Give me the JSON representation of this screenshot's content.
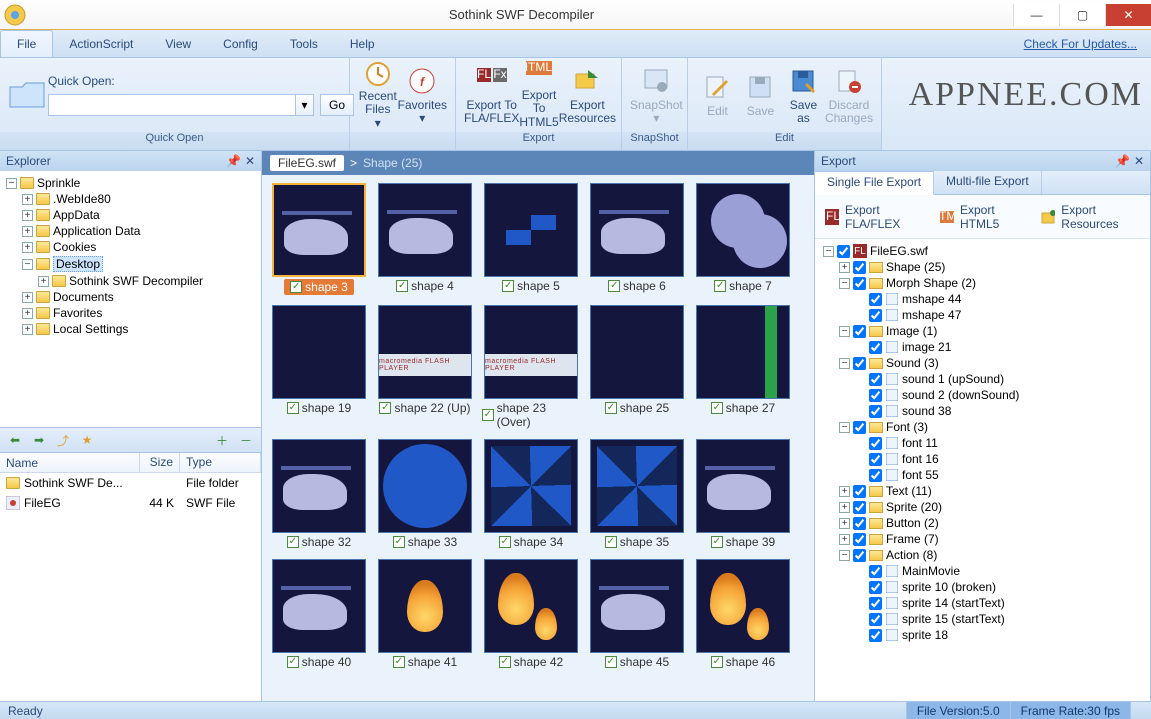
{
  "title": "Sothink SWF Decompiler",
  "watermark": "APPNEE.COM",
  "menubar": {
    "items": [
      "File",
      "ActionScript",
      "View",
      "Config",
      "Tools",
      "Help"
    ],
    "updates": "Check For Updates..."
  },
  "ribbon": {
    "quick_open": {
      "label": "Quick Open:",
      "go": "Go",
      "group": "Quick Open"
    },
    "recent": "Recent Files",
    "favorites": "Favorites",
    "export_fla": "Export To FLA/FLEX",
    "export_html5": "Export To HTML5",
    "export_res": "Export Resources",
    "export_group": "Export",
    "snapshot": "SnapShot",
    "snapshot_group": "SnapShot",
    "edit": "Edit",
    "save": "Save",
    "save_as": "Save as",
    "discard": "Discard Changes",
    "edit_group": "Edit"
  },
  "explorer": {
    "title": "Explorer",
    "root": "Sprinkle",
    "children": [
      ".WebIde80",
      "AppData",
      "Application Data",
      "Cookies",
      "Desktop",
      "Documents",
      "Favorites",
      "Local Settings"
    ],
    "desktop_child": "Sothink SWF Decompiler"
  },
  "file_list": {
    "cols": {
      "name": "Name",
      "size": "Size",
      "type": "Type"
    },
    "rows": [
      {
        "name": "Sothink SWF De...",
        "size": "",
        "type": "File folder",
        "icon": "folder"
      },
      {
        "name": "FileEG",
        "size": "44 K",
        "type": "SWF File",
        "icon": "swf"
      }
    ]
  },
  "breadcrumb": {
    "file": "FileEG.swf",
    "sep": ">",
    "section": "Shape (25)"
  },
  "thumbs": [
    {
      "id": "shape 3",
      "kind": "heli",
      "selected": true
    },
    {
      "id": "shape 4",
      "kind": "heli"
    },
    {
      "id": "shape 5",
      "kind": "bowtie"
    },
    {
      "id": "shape 6",
      "kind": "heli"
    },
    {
      "id": "shape 7",
      "kind": "clouds"
    },
    {
      "id": "shape 19",
      "kind": "plain"
    },
    {
      "id": "shape 22 (Up)",
      "kind": "mm"
    },
    {
      "id": "shape 23 (Over)",
      "kind": "mm"
    },
    {
      "id": "shape 25",
      "kind": "plain"
    },
    {
      "id": "shape 27",
      "kind": "vstripe"
    },
    {
      "id": "shape 32",
      "kind": "heli"
    },
    {
      "id": "shape 33",
      "kind": "circle"
    },
    {
      "id": "shape 34",
      "kind": "cross4"
    },
    {
      "id": "shape 35",
      "kind": "cross4"
    },
    {
      "id": "shape 39",
      "kind": "heli"
    },
    {
      "id": "shape 40",
      "kind": "heli"
    },
    {
      "id": "shape 41",
      "kind": "flame"
    },
    {
      "id": "shape 42",
      "kind": "flame2"
    },
    {
      "id": "shape 45",
      "kind": "heli"
    },
    {
      "id": "shape 46",
      "kind": "flame2"
    }
  ],
  "mm_text": "macromedia FLASH PLAYER",
  "export": {
    "title": "Export",
    "tabs": [
      "Single File Export",
      "Multi-file Export"
    ],
    "actions": {
      "fla": "Export FLA/FLEX",
      "html5": "Export HTML5",
      "res": "Export Resources"
    },
    "root": "FileEG.swf",
    "nodes": [
      {
        "label": "Shape (25)",
        "children": []
      },
      {
        "label": "Morph Shape (2)",
        "children": [
          "mshape 44",
          "mshape 47"
        ]
      },
      {
        "label": "Image (1)",
        "children": [
          "image 21"
        ]
      },
      {
        "label": "Sound (3)",
        "children": [
          "sound 1 (upSound)",
          "sound 2 (downSound)",
          "sound 38"
        ]
      },
      {
        "label": "Font (3)",
        "children": [
          "font 11",
          "font 16",
          "font 55"
        ]
      },
      {
        "label": "Text (11)",
        "children": []
      },
      {
        "label": "Sprite (20)",
        "children": []
      },
      {
        "label": "Button (2)",
        "children": []
      },
      {
        "label": "Frame (7)",
        "children": []
      },
      {
        "label": "Action (8)",
        "children": [
          "MainMovie",
          "sprite 10 (broken)",
          "sprite 14 (startText)",
          "sprite 15 (startText)",
          "sprite 18"
        ]
      }
    ]
  },
  "status": {
    "ready": "Ready",
    "version": "File Version:5.0",
    "fps": "Frame Rate:30 fps"
  }
}
